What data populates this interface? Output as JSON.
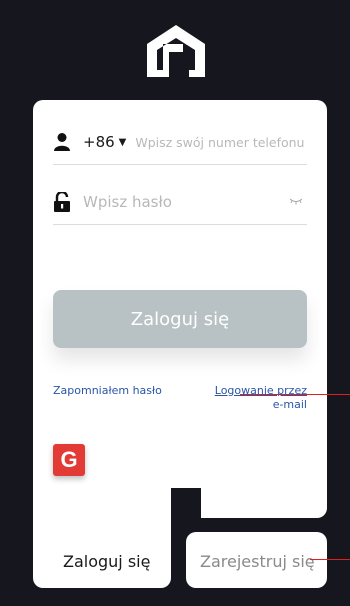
{
  "login_form": {
    "country_code": "+86",
    "phone_placeholder": "Wpisz swój numer telefonu",
    "password_placeholder": "Wpisz hasło",
    "login_button": "Zaloguj się",
    "forgot_password": "Zapomniałem hasło",
    "email_login_line1": "Logowanie przez",
    "email_login_line2": "e-mail",
    "google_label": "G"
  },
  "tabs": {
    "login": "Zaloguj się",
    "register": "Zarejestruj się"
  },
  "colors": {
    "background": "#16161f",
    "button": "#b8c2c4",
    "link": "#2a55a6",
    "google": "#e23a35",
    "annotation": "#e02020"
  },
  "icons": [
    "app-logo-icon",
    "user-icon",
    "caret-down-icon",
    "lock-icon",
    "eye-hidden-icon",
    "google-icon"
  ]
}
